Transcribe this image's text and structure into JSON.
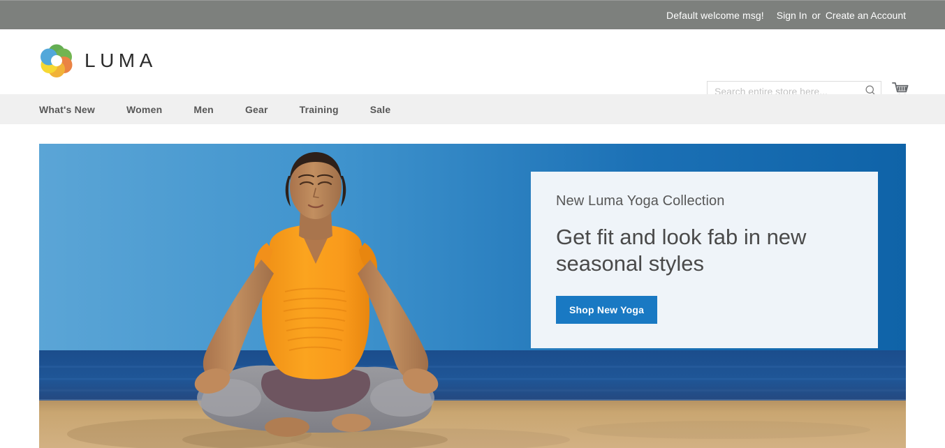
{
  "top_panel": {
    "welcome_message": "Default welcome msg!",
    "sign_in_label": "Sign In",
    "separator": "or",
    "create_account_label": "Create an Account",
    "background_color": "#7d807d"
  },
  "header": {
    "logo_text": "LUMA",
    "logo_icon": "luma-rings-logo",
    "search": {
      "placeholder": "Search entire store here...",
      "value": "",
      "icon": "search-icon"
    },
    "cart": {
      "icon": "shopping-cart-icon",
      "count": ""
    }
  },
  "nav": {
    "items": [
      {
        "label": "What's New"
      },
      {
        "label": "Women"
      },
      {
        "label": "Men"
      },
      {
        "label": "Gear"
      },
      {
        "label": "Training"
      },
      {
        "label": "Sale"
      }
    ],
    "background_color": "#f0f0f0"
  },
  "hero": {
    "image_alt": "Woman meditating in lotus pose on a beach",
    "panel": {
      "eyebrow": "New Luma Yoga Collection",
      "headline": "Get fit and look fab in new seasonal styles",
      "cta_label": "Shop New Yoga",
      "cta_color": "#1979c3",
      "background_color": "#eff4f9"
    },
    "colors": {
      "sky_left": "#4f9ed3",
      "sky_right": "#0f63a8",
      "ocean": "#1d4b87",
      "sand": "#c9a46f",
      "shirt": "#f79b1e",
      "leggings": "#8e8e93"
    }
  }
}
